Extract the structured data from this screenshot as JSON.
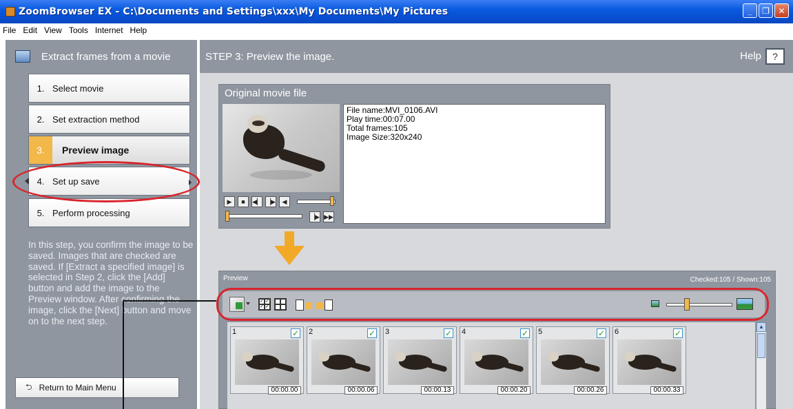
{
  "window": {
    "title": "ZoomBrowser EX  -  C:\\Documents and Settings\\xxx\\My Documents\\My Pictures",
    "buttons": [
      "_",
      "❐",
      "✕"
    ]
  },
  "menu": [
    "File",
    "Edit",
    "View",
    "Tools",
    "Internet",
    "Help"
  ],
  "left_panel": {
    "header": "Extract frames from a movie",
    "steps": [
      {
        "num": "1.",
        "label": "Select movie"
      },
      {
        "num": "2.",
        "label": "Set extraction method"
      },
      {
        "num": "3.",
        "label": "Preview image"
      },
      {
        "num": "4.",
        "label": "Set up save"
      },
      {
        "num": "5.",
        "label": "Perform processing"
      }
    ],
    "description": "In this step, you confirm the image to be saved. Images that are checked are saved. If [Extract a specified image] is selected in Step 2, click the [Add] button and add the image to the Preview window. After confirming the image, click the [Next] button and move on to the next step.",
    "return_button": "Return to Main Menu"
  },
  "main": {
    "header": "STEP 3: Preview the image.",
    "help_label": "Help",
    "help_button": "?",
    "movie_box": {
      "title": "Original movie file",
      "file_name": "File name:MVI_0106.AVI",
      "play_time": "Play time:00:07.00",
      "total_frames": "Total frames:105",
      "image_size": "Image Size:320x240"
    },
    "preview": {
      "title": "Preview",
      "counts": "Checked:105 / Shown:105",
      "thumbnails": [
        {
          "num": "1",
          "time": "00:00.00",
          "checked": "✓"
        },
        {
          "num": "2",
          "time": "00:00.06",
          "checked": "✓"
        },
        {
          "num": "3",
          "time": "00:00.13",
          "checked": "✓"
        },
        {
          "num": "4",
          "time": "00:00.20",
          "checked": "✓"
        },
        {
          "num": "5",
          "time": "00:00.26",
          "checked": "✓"
        },
        {
          "num": "6",
          "time": "00:00.33",
          "checked": "✓"
        }
      ]
    }
  },
  "colors": {
    "panel_gray": "#8f96a0",
    "active_step": "#f2b84a",
    "annotation_red": "#d9242c",
    "arrow_orange": "#f3a928"
  }
}
